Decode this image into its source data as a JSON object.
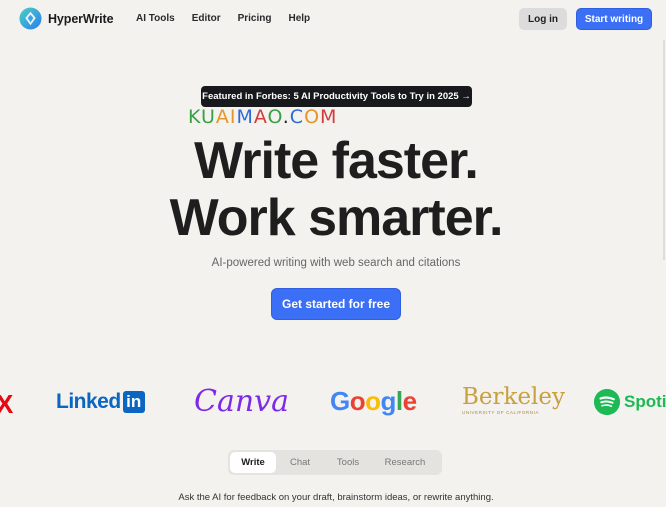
{
  "nav": {
    "brand": "HyperWrite",
    "links": [
      "AI Tools",
      "Editor",
      "Pricing",
      "Help"
    ],
    "login_label": "Log in",
    "start_label": "Start writing"
  },
  "hero": {
    "announcement": "Featured in Forbes: 5 AI Productivity Tools to Try in 2025 →",
    "watermark": "KUAIMAO.COM",
    "title_line1": "Write faster.",
    "title_line2": "Work smarter.",
    "subtitle": "AI-powered writing with web search and citations",
    "cta_label": "Get started for free"
  },
  "logos": {
    "netflix_partial": "X",
    "linkedin_text": "Linked",
    "linkedin_box": "in",
    "canva": "Canva",
    "google": [
      "G",
      "o",
      "o",
      "g",
      "l",
      "e"
    ],
    "berkeley": "Berkeley",
    "berkeley_sub": "UNIVERSITY OF CALIFORNIA",
    "spotify": "Spotif"
  },
  "tabs": {
    "items": [
      "Write",
      "Chat",
      "Tools",
      "Research"
    ],
    "active": "Write"
  },
  "tagline": "Ask the AI for feedback on your draft, brainstorm ideas, or rewrite anything.",
  "colors": {
    "background": "#f3f2ee",
    "accent": "#3b6ff5",
    "pill_dark": "#17191c"
  }
}
